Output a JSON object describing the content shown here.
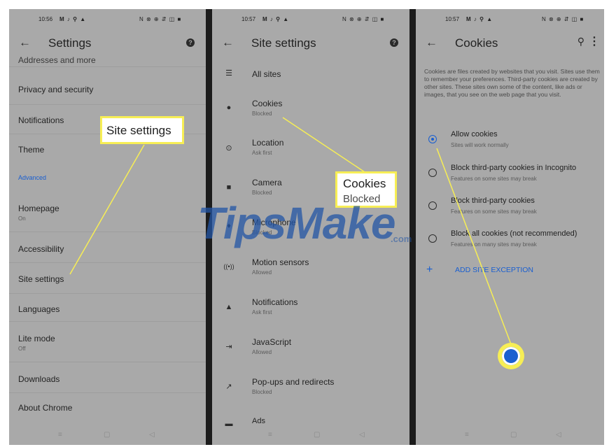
{
  "settings": {
    "status": {
      "time": "10:56",
      "icons_left": "M ♪ ⚲ ▲",
      "icons_right": "N ⊗ ⊕ ⇵ ◫ ■"
    },
    "title": "Settings",
    "partial_item": "Addresses and more",
    "items": [
      {
        "label": "Privacy and security"
      },
      {
        "label": "Notifications"
      },
      {
        "label": "Theme"
      },
      {
        "label": "Advanced"
      },
      {
        "label": "Homepage",
        "sub": "On"
      },
      {
        "label": "Accessibility"
      },
      {
        "label": "Site settings"
      },
      {
        "label": "Languages"
      },
      {
        "label": "Lite mode",
        "sub": "Off"
      },
      {
        "label": "Downloads"
      },
      {
        "label": "About Chrome"
      }
    ],
    "callout": "Site settings"
  },
  "site_settings": {
    "status": {
      "time": "10:57",
      "icons_left": "M ♪ ⚲ ▲",
      "icons_right": "N ⊗ ⊕ ⇵ ◫ ■"
    },
    "title": "Site settings",
    "items": [
      {
        "label": "All sites",
        "icon": "list-icon"
      },
      {
        "label": "Cookies",
        "sub": "Blocked",
        "icon": "cookie-icon"
      },
      {
        "label": "Location",
        "sub": "Ask first",
        "icon": "location-pin-icon"
      },
      {
        "label": "Camera",
        "sub": "Blocked",
        "icon": "camera-icon"
      },
      {
        "label": "Microphone",
        "sub": "Blocked",
        "icon": "microphone-icon"
      },
      {
        "label": "Motion sensors",
        "sub": "Allowed",
        "icon": "motion-sensor-icon"
      },
      {
        "label": "Notifications",
        "sub": "Ask first",
        "icon": "bell-icon"
      },
      {
        "label": "JavaScript",
        "sub": "Allowed",
        "icon": "javascript-icon"
      },
      {
        "label": "Pop-ups and redirects",
        "sub": "Blocked",
        "icon": "popup-icon"
      },
      {
        "label": "Ads",
        "icon": "ads-icon"
      }
    ],
    "callout": {
      "title": "Cookies",
      "sub": "Blocked"
    }
  },
  "cookies": {
    "status": {
      "time": "10:57",
      "icons_left": "M ♪ ⚲ ▲",
      "icons_right": "N ⊗ ⊕ ⇵ ◫ ■"
    },
    "title": "Cookies",
    "description": "Cookies are files created by websites that you visit. Sites use them to remember your preferences. Third-party cookies are created by other sites. These sites own some of the content, like ads or images, that you see on the web page that you visit.",
    "options": [
      {
        "label": "Allow cookies",
        "sub": "Sites will work normally",
        "selected": true
      },
      {
        "label": "Block third-party cookies in Incognito",
        "sub": "Features on some sites may break",
        "selected": false
      },
      {
        "label": "Block third-party cookies",
        "sub": "Features on some sites may break",
        "selected": false
      },
      {
        "label": "Block all cookies (not recommended)",
        "sub": "Features on many sites may break",
        "selected": false
      }
    ],
    "add_exception": "ADD SITE EXCEPTION"
  },
  "navbar": {
    "menu": "≡",
    "home": "▢",
    "back": "◁"
  },
  "watermark": {
    "brand": "TipsMake",
    "suffix": ".com"
  },
  "colors": {
    "accent": "#1a5fd0",
    "highlight": "#f7ee55",
    "panel": "#a9a9a9"
  }
}
